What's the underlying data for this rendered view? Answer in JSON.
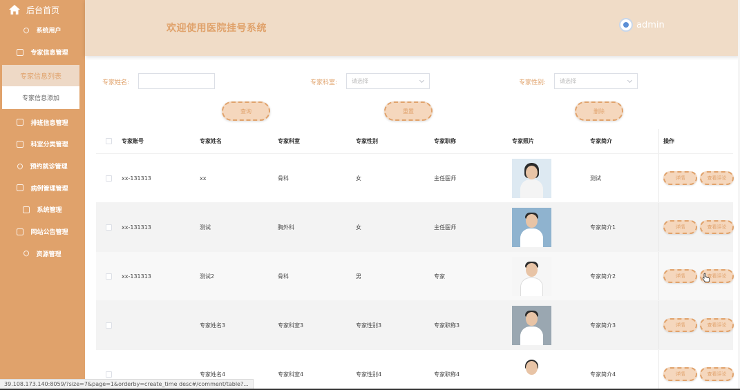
{
  "sidebar": {
    "home_label": "后台首页",
    "items": [
      {
        "label": "系统用户",
        "icon": "heart-icon"
      },
      {
        "label": "专家信息管理",
        "icon": "edit-icon"
      }
    ],
    "submenu": {
      "active_label": "专家信息列表",
      "add_label": "专家信息添加"
    },
    "items_after": [
      {
        "label": "排班信息管理",
        "icon": "list-icon"
      },
      {
        "label": "科室分类管理",
        "icon": "edit-icon"
      },
      {
        "label": "预约就诊管理",
        "icon": "heart-icon"
      },
      {
        "label": "病例管理管理",
        "icon": "edit-icon"
      },
      {
        "label": "系统管理",
        "icon": "close-box-icon"
      },
      {
        "label": "网站公告管理",
        "icon": "edit-icon"
      },
      {
        "label": "资源管理",
        "icon": "heart-icon"
      }
    ]
  },
  "header": {
    "title": "欢迎使用医院挂号系统",
    "user": "admin"
  },
  "filters": {
    "name_label": "专家姓名:",
    "name_value": "",
    "dept_label": "专家科室:",
    "dept_placeholder": "请选择",
    "sex_label": "专家性别:",
    "sex_placeholder": "请选择"
  },
  "actions": {
    "query": "查询",
    "reset": "重置",
    "delete": "删除"
  },
  "table": {
    "headers": [
      "专家账号",
      "专家姓名",
      "专家科室",
      "专家性别",
      "专家职称",
      "专家照片",
      "专家简介",
      "操作"
    ],
    "rows": [
      {
        "account": "xx-131313",
        "name": "xx",
        "dept": "骨科",
        "sex": "女",
        "title": "主任医师",
        "intro": "测试",
        "photo": "female-doctor-photo"
      },
      {
        "account": "xx-131313",
        "name": "测试",
        "dept": "胸外科",
        "sex": "女",
        "title": "主任医师",
        "intro": "专家简介1",
        "photo": "male-doctor-photo"
      },
      {
        "account": "xx-131313",
        "name": "测试2",
        "dept": "骨科",
        "sex": "男",
        "title": "专家",
        "intro": "专家简介2",
        "photo": "male-doctor-photo"
      },
      {
        "account": "",
        "name": "专家姓名3",
        "dept": "专家科室3",
        "sex": "专家性别3",
        "title": "专家职称3",
        "intro": "专家简介3",
        "photo": "male-doctor-photo"
      },
      {
        "account": "",
        "name": "专家姓名4",
        "dept": "专家科室4",
        "sex": "专家性别4",
        "title": "专家职称4",
        "intro": "专家简介4",
        "photo": "female-doctor-photo"
      }
    ],
    "op_detail": "详情",
    "op_review": "查看评论"
  },
  "status_url": "39.108.173.140:8059/?size=7&page=1&orderby=create_time desc#/comment/table?...",
  "colors": {
    "accent": "#e0a26b",
    "header_bg": "#f0dcc7",
    "button_bg": "#f5d7bd"
  }
}
